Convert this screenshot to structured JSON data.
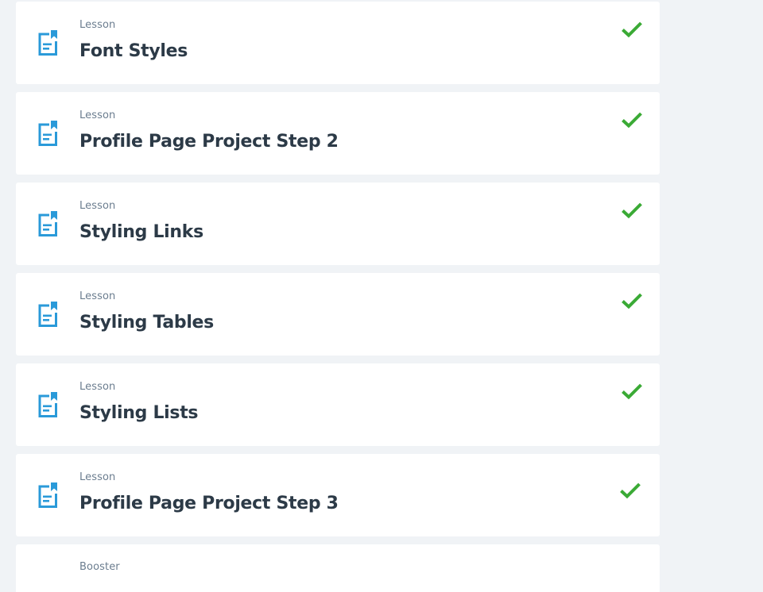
{
  "colors": {
    "background": "#f0f3f6",
    "card": "#ffffff",
    "icon_blue": "#2a9ad9",
    "check_green": "#3aaa35",
    "title_text": "#2c3a47",
    "type_text": "#6b7d8f"
  },
  "lessons": [
    {
      "type": "Lesson",
      "title": "Font Styles",
      "icon": "document-icon",
      "status": "completed",
      "status_icon": "checkmark-icon"
    },
    {
      "type": "Lesson",
      "title": "Profile Page Project Step 2",
      "icon": "document-icon",
      "status": "completed",
      "status_icon": "checkmark-icon"
    },
    {
      "type": "Lesson",
      "title": "Styling Links",
      "icon": "document-icon",
      "status": "completed",
      "status_icon": "checkmark-icon"
    },
    {
      "type": "Lesson",
      "title": "Styling Tables",
      "icon": "document-icon",
      "status": "completed",
      "status_icon": "checkmark-icon"
    },
    {
      "type": "Lesson",
      "title": "Styling Lists",
      "icon": "document-icon",
      "status": "completed",
      "status_icon": "checkmark-icon"
    },
    {
      "type": "Lesson",
      "title": "Profile Page Project Step 3",
      "icon": "document-icon",
      "status": "completed",
      "status_icon": "checkmark-icon"
    },
    {
      "type": "Booster"
    }
  ]
}
